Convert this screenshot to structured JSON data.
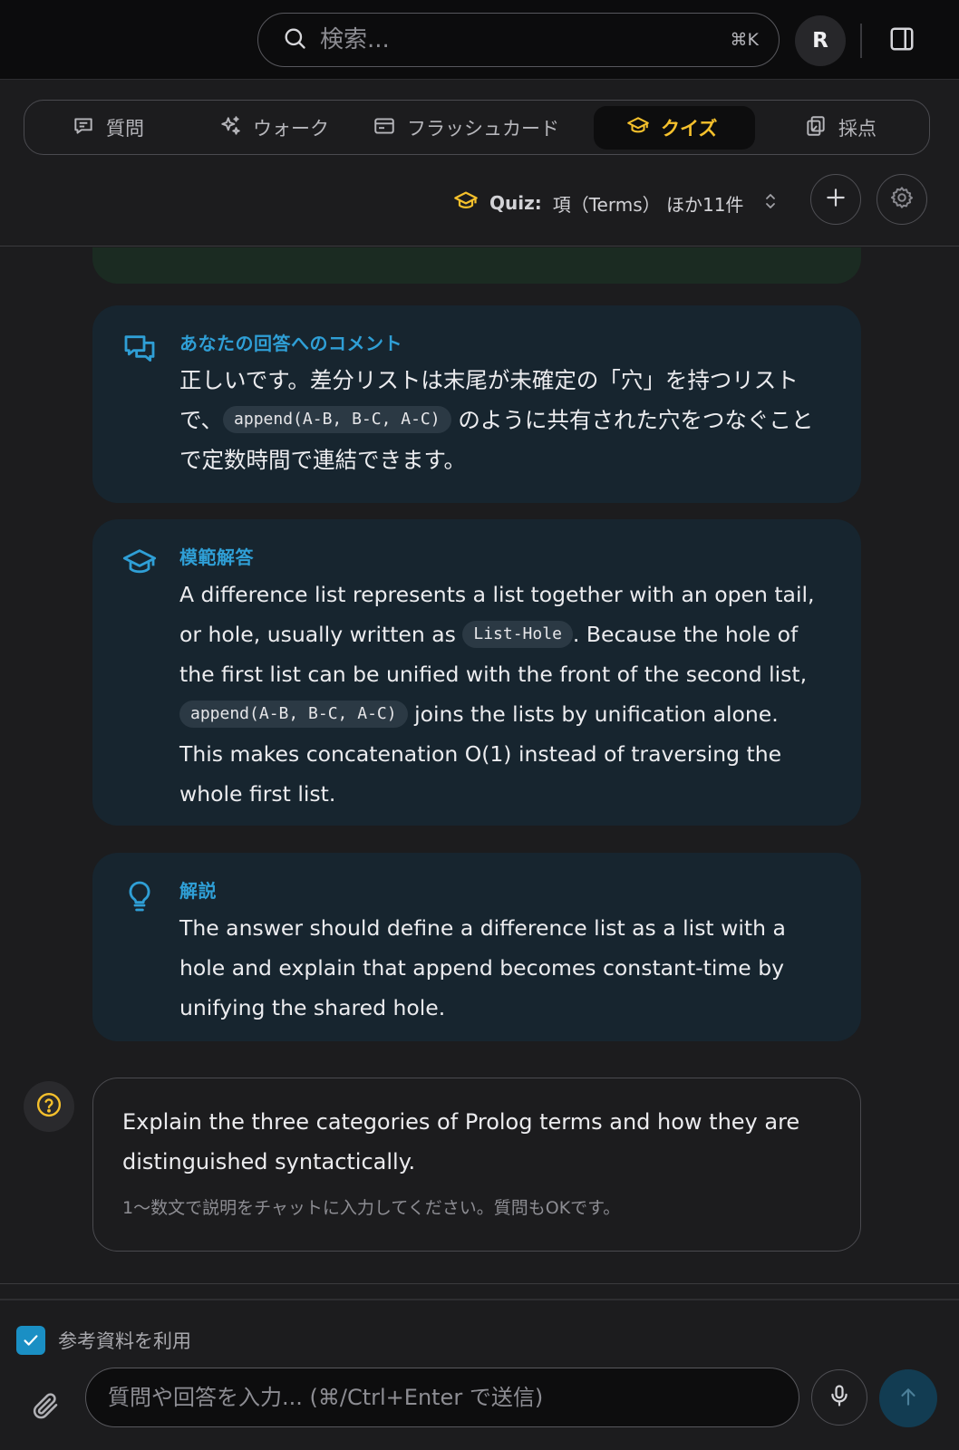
{
  "colors": {
    "accent_blue": "#2f9fd6",
    "accent_yellow": "#f5c02c",
    "card_bg": "#17252f",
    "background": "#1c1c1e"
  },
  "header": {
    "search_placeholder": "検索...",
    "search_shortcut": "⌘K",
    "avatar_initial": "R",
    "icons": [
      "search-icon",
      "sidebar-panel-icon"
    ]
  },
  "tabs": [
    {
      "label": "質問",
      "icon": "chat-icon",
      "active": false
    },
    {
      "label": "ウォーク",
      "icon": "sparkles-icon",
      "active": false
    },
    {
      "label": "フラッシュカード",
      "icon": "card-icon",
      "active": false
    },
    {
      "label": "クイズ",
      "icon": "graduation-cap-icon",
      "active": true
    },
    {
      "label": "採点",
      "icon": "clipboard-icon",
      "active": false
    }
  ],
  "quiz_selector": {
    "prefix": "Quiz:",
    "title": "項（Terms） ほか11件"
  },
  "cards": {
    "comment": {
      "label": "あなたの回答へのコメント",
      "text_1": "正しいです。差分リストは末尾が未確定の「穴」を持つリストで、",
      "code_1": "append(A-B, B-C, A-C)",
      "text_2": "のように共有された穴をつなぐことで定数時間で連結できます。"
    },
    "model_answer": {
      "label": "模範解答",
      "text_1": "A difference list represents a list together with an open tail, or hole, usually written as",
      "code_1": "List-Hole",
      "text_2": ". Because the hole of the first list can be unified with the front of the second list,",
      "code_2": "append(A-B, B-C, A-C)",
      "text_3": "joins the lists by unification alone. This makes concatenation O(1) instead of traversing the whole first list."
    },
    "explanation": {
      "label": "解説",
      "text": "The answer should define a difference list as a list with a hole and explain that append becomes constant-time by unifying the shared hole."
    }
  },
  "question": {
    "text": "Explain the three categories of Prolog terms and how they are distinguished syntactically.",
    "hint": "1〜数文で説明をチャットに入力してください。質問もOKです。"
  },
  "footer": {
    "reference_label": "参考資料を利用",
    "reference_checked": true,
    "input_placeholder": "質問や回答を入力... (⌘/Ctrl+Enter で送信)"
  }
}
